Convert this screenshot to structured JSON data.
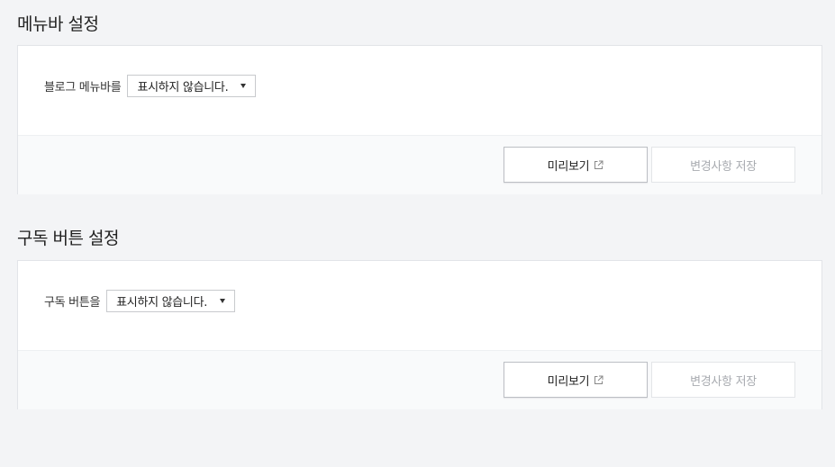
{
  "menubar": {
    "title": "메뉴바 설정",
    "label": "블로그 메뉴바를",
    "select_value": "표시하지 않습니다.",
    "preview_label": "미리보기",
    "save_label": "변경사항 저장"
  },
  "subscribe": {
    "title": "구독 버튼 설정",
    "label": "구독 버튼을",
    "select_value": "표시하지 않습니다.",
    "preview_label": "미리보기",
    "save_label": "변경사항 저장"
  },
  "colors": {
    "page_bg": "#f3f4f6",
    "card_bg": "#ffffff",
    "footer_bg": "#f9fafb",
    "disabled_text": "#a8abb0"
  },
  "icons": {
    "select_caret": "caret-down-icon",
    "preview_icon": "external-link-icon"
  }
}
